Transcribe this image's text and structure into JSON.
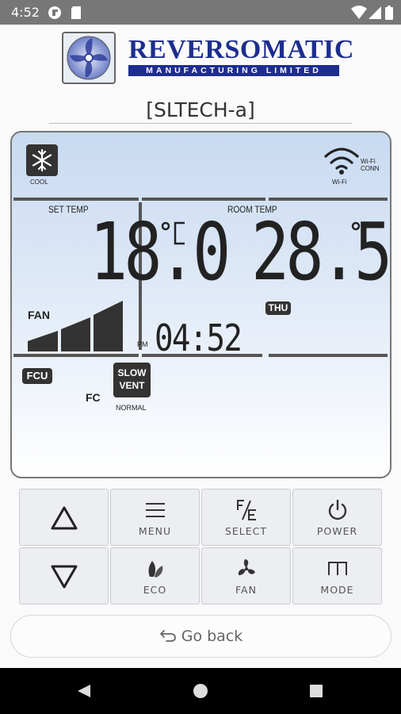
{
  "status_bar": {
    "time": "4:52"
  },
  "header": {
    "brand": "REVERSOMATIC",
    "brand_sub": "MANUFACTURING LIMITED",
    "device_name": "[SLTECH-a]"
  },
  "lcd": {
    "mode_label": "COOL",
    "wifi_label": "Wi-Fi",
    "wifi_conn_line1": "Wi-Fi",
    "wifi_conn_line2": "CONN",
    "set_temp_label": "SET TEMP",
    "room_temp_label": "ROOM TEMP",
    "set_temp_value": "18.0",
    "room_temp_value": "28.5",
    "temp_unit": "°C",
    "fan_label": "FAN",
    "fan_level_bars": 3,
    "day": "THU",
    "clock_ampm": "PM",
    "clock_time": "04:52",
    "fcu_badge": "FCU",
    "fc_label": "FC",
    "slow_vent_line1": "SLOW",
    "slow_vent_line2": "VENT",
    "normal_label": "NORMAL"
  },
  "controls": {
    "up": "",
    "menu": "MENU",
    "select": "SELECT",
    "power": "POWER",
    "down": "",
    "eco": "ECO",
    "fan": "FAN",
    "mode": "MODE"
  },
  "footer": {
    "go_back": "Go back"
  },
  "colors": {
    "brand_blue": "#1d2e8f",
    "lcd_segment": "#222222",
    "status_bar": "#777777"
  }
}
